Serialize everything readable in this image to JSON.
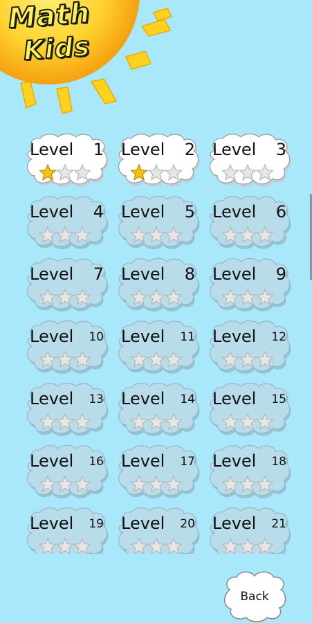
{
  "app": {
    "logo_line1": "Math",
    "logo_line2": "Kids"
  },
  "level_word": "Level",
  "levels": [
    {
      "number": "1",
      "stars_earned": 1,
      "unlocked": true
    },
    {
      "number": "2",
      "stars_earned": 1,
      "unlocked": true
    },
    {
      "number": "3",
      "stars_earned": 0,
      "unlocked": true
    },
    {
      "number": "4",
      "stars_earned": 0,
      "unlocked": false
    },
    {
      "number": "5",
      "stars_earned": 0,
      "unlocked": false
    },
    {
      "number": "6",
      "stars_earned": 0,
      "unlocked": false
    },
    {
      "number": "7",
      "stars_earned": 0,
      "unlocked": false
    },
    {
      "number": "8",
      "stars_earned": 0,
      "unlocked": false
    },
    {
      "number": "9",
      "stars_earned": 0,
      "unlocked": false
    },
    {
      "number": "10",
      "stars_earned": 0,
      "unlocked": false
    },
    {
      "number": "11",
      "stars_earned": 0,
      "unlocked": false
    },
    {
      "number": "12",
      "stars_earned": 0,
      "unlocked": false
    },
    {
      "number": "13",
      "stars_earned": 0,
      "unlocked": false
    },
    {
      "number": "14",
      "stars_earned": 0,
      "unlocked": false
    },
    {
      "number": "15",
      "stars_earned": 0,
      "unlocked": false
    },
    {
      "number": "16",
      "stars_earned": 0,
      "unlocked": false
    },
    {
      "number": "17",
      "stars_earned": 0,
      "unlocked": false
    },
    {
      "number": "18",
      "stars_earned": 0,
      "unlocked": false
    },
    {
      "number": "19",
      "stars_earned": 0,
      "unlocked": false
    },
    {
      "number": "20",
      "stars_earned": 0,
      "unlocked": false
    },
    {
      "number": "21",
      "stars_earned": 0,
      "unlocked": false
    }
  ],
  "stars_per_level": 3,
  "back_button": {
    "label": "Back"
  },
  "colors": {
    "background": "#a9e8fb",
    "cloud_unlocked": "#ffffff",
    "cloud_locked": "#b9dcea",
    "star_earned": "#f2c20f",
    "star_empty": "#e6e6e6",
    "sun": "#ffd23a"
  }
}
